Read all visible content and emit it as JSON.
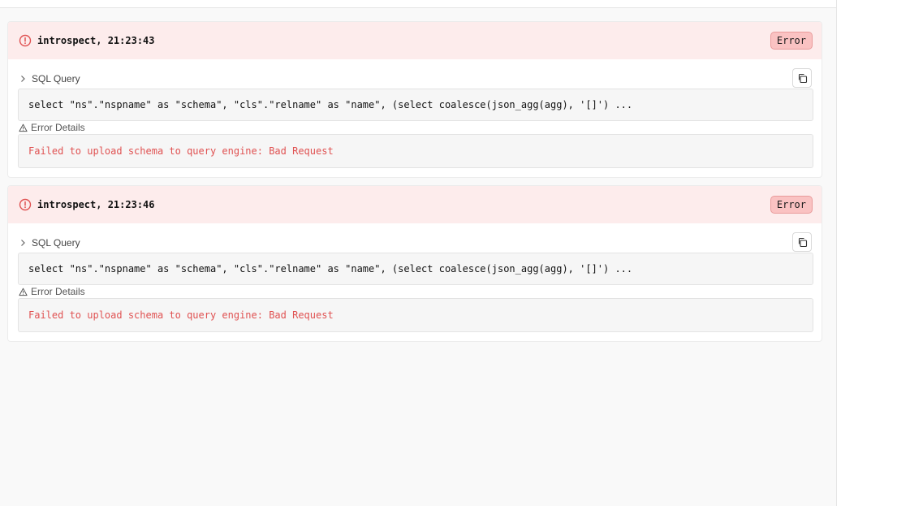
{
  "entries": [
    {
      "title": "introspect, 21:23:43",
      "status": "Error",
      "query_label": "SQL Query",
      "query": "select \"ns\".\"nspname\" as \"schema\", \"cls\".\"relname\" as \"name\", (select coalesce(json_agg(agg), '[]') ...",
      "details_label": "Error Details",
      "error_message": "Failed to upload schema to query engine: Bad Request"
    },
    {
      "title": "introspect, 21:23:46",
      "status": "Error",
      "query_label": "SQL Query",
      "query": "select \"ns\".\"nspname\" as \"schema\", \"cls\".\"relname\" as \"name\", (select coalesce(json_agg(agg), '[]') ...",
      "details_label": "Error Details",
      "error_message": "Failed to upload schema to query engine: Bad Request"
    }
  ],
  "icons": {
    "status": "alert-circle-icon",
    "expand": "chevron-right-icon",
    "copy": "copy-icon",
    "details": "warning-triangle-icon"
  },
  "colors": {
    "error_header_bg": "#fdecec",
    "error_accent": "#e05252",
    "badge_bg": "#fac2c2"
  }
}
